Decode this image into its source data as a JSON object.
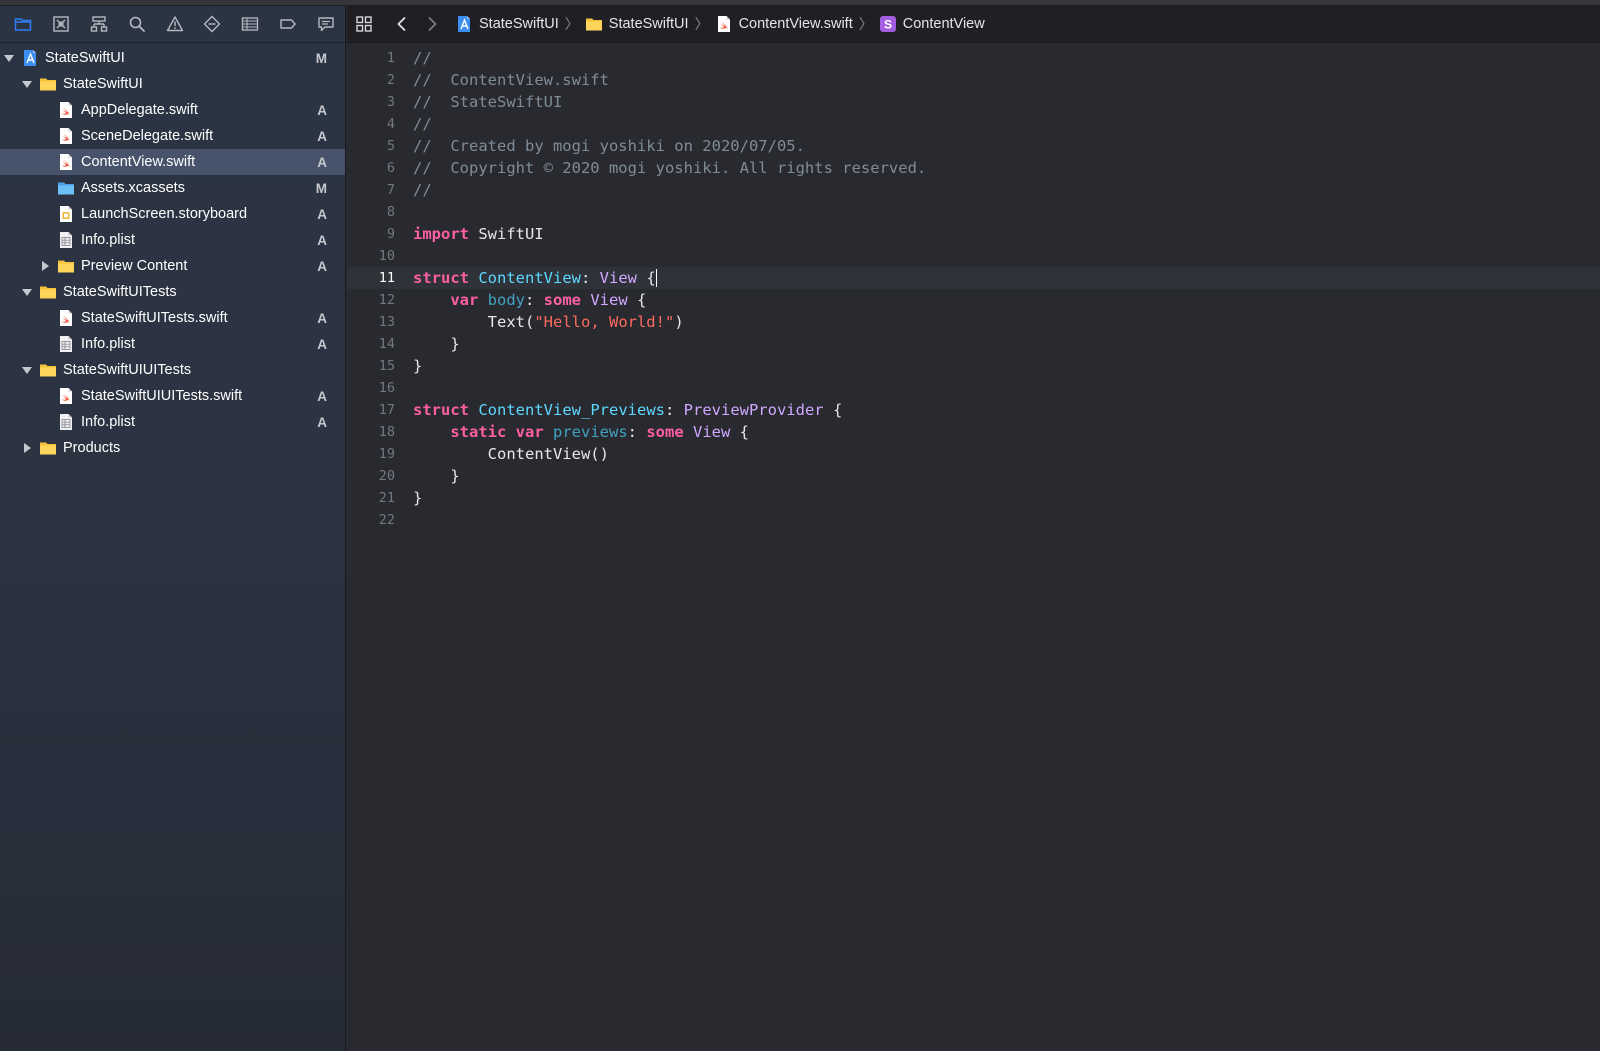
{
  "colors": {
    "accent": "#2e7cf6",
    "sidebar_bg": "#2c3443",
    "editor_bg": "#292a30",
    "selected_row": "#46536a",
    "keyword": "#fc5fa3",
    "type": "#5dd8ff",
    "system_type": "#d0a8ff",
    "string": "#fc6a5d",
    "comment": "#7f8c98"
  },
  "navigator_toolbar": [
    {
      "name": "project-navigator-icon",
      "active": true
    },
    {
      "name": "source-control-navigator-icon"
    },
    {
      "name": "symbol-navigator-icon"
    },
    {
      "name": "find-navigator-icon"
    },
    {
      "name": "issue-navigator-icon"
    },
    {
      "name": "test-navigator-icon"
    },
    {
      "name": "debug-navigator-icon"
    },
    {
      "name": "breakpoint-navigator-icon"
    },
    {
      "name": "report-navigator-icon"
    }
  ],
  "tree": [
    {
      "label": "StateSwiftUI",
      "status": "M",
      "icon": "project-icon",
      "disclosure": "open",
      "depth": 0
    },
    {
      "label": "StateSwiftUI",
      "status": "",
      "icon": "folder-icon",
      "disclosure": "open",
      "depth": 1
    },
    {
      "label": "AppDelegate.swift",
      "status": "A",
      "icon": "swift-file-icon",
      "disclosure": "",
      "depth": 2
    },
    {
      "label": "SceneDelegate.swift",
      "status": "A",
      "icon": "swift-file-icon",
      "disclosure": "",
      "depth": 2
    },
    {
      "label": "ContentView.swift",
      "status": "A",
      "icon": "swift-file-icon",
      "disclosure": "",
      "depth": 2,
      "selected": true
    },
    {
      "label": "Assets.xcassets",
      "status": "M",
      "icon": "assets-folder-icon",
      "disclosure": "",
      "depth": 2
    },
    {
      "label": "LaunchScreen.storyboard",
      "status": "A",
      "icon": "storyboard-file-icon",
      "disclosure": "",
      "depth": 2
    },
    {
      "label": "Info.plist",
      "status": "A",
      "icon": "plist-file-icon",
      "disclosure": "",
      "depth": 2
    },
    {
      "label": "Preview Content",
      "status": "A",
      "icon": "folder-icon",
      "disclosure": "closed",
      "depth": 2
    },
    {
      "label": "StateSwiftUITests",
      "status": "",
      "icon": "folder-icon",
      "disclosure": "open",
      "depth": 1
    },
    {
      "label": "StateSwiftUITests.swift",
      "status": "A",
      "icon": "swift-file-icon",
      "disclosure": "",
      "depth": 2
    },
    {
      "label": "Info.plist",
      "status": "A",
      "icon": "plist-file-icon",
      "disclosure": "",
      "depth": 2
    },
    {
      "label": "StateSwiftUIUITests",
      "status": "",
      "icon": "folder-icon",
      "disclosure": "open",
      "depth": 1
    },
    {
      "label": "StateSwiftUIUITests.swift",
      "status": "A",
      "icon": "swift-file-icon",
      "disclosure": "",
      "depth": 2
    },
    {
      "label": "Info.plist",
      "status": "A",
      "icon": "plist-file-icon",
      "disclosure": "",
      "depth": 2
    },
    {
      "label": "Products",
      "status": "",
      "icon": "folder-icon",
      "disclosure": "closed",
      "depth": 1
    }
  ],
  "jumpbar": {
    "breadcrumbs": [
      {
        "label": "StateSwiftUI",
        "icon": "project-icon"
      },
      {
        "label": "StateSwiftUI",
        "icon": "folder-icon"
      },
      {
        "label": "ContentView.swift",
        "icon": "swift-file-white-icon"
      },
      {
        "label": "ContentView",
        "icon": "struct-symbol-icon"
      }
    ]
  },
  "editor": {
    "current_line": 11,
    "cursor_after_line_text": true,
    "lines": [
      [
        [
          "comment",
          "//"
        ]
      ],
      [
        [
          "comment",
          "//  ContentView.swift"
        ]
      ],
      [
        [
          "comment",
          "//  StateSwiftUI"
        ]
      ],
      [
        [
          "comment",
          "//"
        ]
      ],
      [
        [
          "comment",
          "//  Created by mogi yoshiki on 2020/07/05."
        ]
      ],
      [
        [
          "comment",
          "//  Copyright © 2020 mogi yoshiki. All rights reserved."
        ]
      ],
      [
        [
          "comment",
          "//"
        ]
      ],
      [],
      [
        [
          "keyword",
          "import"
        ],
        [
          "plain",
          " SwiftUI"
        ]
      ],
      [],
      [
        [
          "keyword",
          "struct"
        ],
        [
          "plain",
          " "
        ],
        [
          "type",
          "ContentView"
        ],
        [
          "plain",
          ": "
        ],
        [
          "sys",
          "View"
        ],
        [
          "plain",
          " {"
        ]
      ],
      [
        [
          "plain",
          "    "
        ],
        [
          "keyword",
          "var"
        ],
        [
          "plain",
          " "
        ],
        [
          "prop",
          "body"
        ],
        [
          "plain",
          ": "
        ],
        [
          "keyword",
          "some"
        ],
        [
          "plain",
          " "
        ],
        [
          "sys",
          "View"
        ],
        [
          "plain",
          " {"
        ]
      ],
      [
        [
          "plain",
          "        "
        ],
        [
          "plain",
          "Text("
        ],
        [
          "string",
          "\"Hello, World!\""
        ],
        [
          "plain",
          ")"
        ]
      ],
      [
        [
          "plain",
          "    }"
        ]
      ],
      [
        [
          "plain",
          "}"
        ]
      ],
      [],
      [
        [
          "keyword",
          "struct"
        ],
        [
          "plain",
          " "
        ],
        [
          "type",
          "ContentView_Previews"
        ],
        [
          "plain",
          ": "
        ],
        [
          "sys",
          "PreviewProvider"
        ],
        [
          "plain",
          " {"
        ]
      ],
      [
        [
          "plain",
          "    "
        ],
        [
          "keyword",
          "static"
        ],
        [
          "plain",
          " "
        ],
        [
          "keyword",
          "var"
        ],
        [
          "plain",
          " "
        ],
        [
          "prop",
          "previews"
        ],
        [
          "plain",
          ": "
        ],
        [
          "keyword",
          "some"
        ],
        [
          "plain",
          " "
        ],
        [
          "sys",
          "View"
        ],
        [
          "plain",
          " {"
        ]
      ],
      [
        [
          "plain",
          "        "
        ],
        [
          "plain",
          "ContentView()"
        ]
      ],
      [
        [
          "plain",
          "    }"
        ]
      ],
      [
        [
          "plain",
          "}"
        ]
      ],
      []
    ]
  }
}
